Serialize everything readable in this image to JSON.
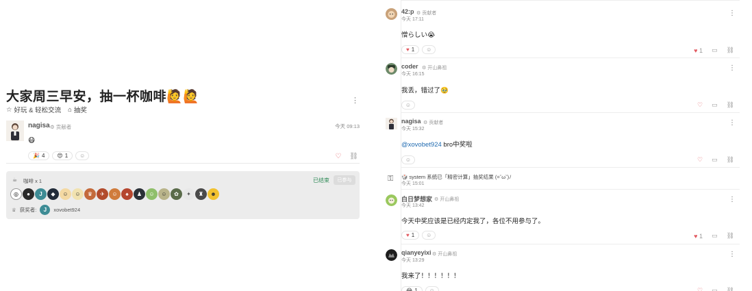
{
  "topic": {
    "title": "大家周三早安，抽一杯咖啡🙋🙋",
    "tags": [
      {
        "icon": "star-outline-icon",
        "label": "好玩 & 轻松交流"
      },
      {
        "icon": "tag-icon",
        "label": "抽奖"
      }
    ],
    "menu": "⋮"
  },
  "op": {
    "author": "nagisa",
    "role": "⚙ 贡献者",
    "time": "今天 09:13",
    "body": "😷",
    "reactions": [
      {
        "emoji": "🎉",
        "count": "4"
      },
      {
        "emoji": "😍",
        "count": "1"
      }
    ],
    "add_reaction": "☺"
  },
  "giveaway": {
    "icon": "☕",
    "prize": "咖啡  x 1",
    "status": "已结束",
    "button": "已参与",
    "participants": [
      {
        "bg": "#ffffff",
        "fg": "#000",
        "glyph": "◎"
      },
      {
        "bg": "#2a2a2a",
        "fg": "#fff",
        "glyph": "●"
      },
      {
        "bg": "#3e8c95",
        "fg": "#fff",
        "glyph": "J"
      },
      {
        "bg": "#222c3a",
        "fg": "#fff",
        "glyph": "◆"
      },
      {
        "bg": "#f4d9a3",
        "fg": "#333",
        "glyph": "☺"
      },
      {
        "bg": "#f1e2b0",
        "fg": "#333",
        "glyph": "☺"
      },
      {
        "bg": "#c46a3b",
        "fg": "#fff",
        "glyph": "♛"
      },
      {
        "bg": "#b24b2c",
        "fg": "#fff",
        "glyph": "✈"
      },
      {
        "bg": "#d07c3c",
        "fg": "#fff",
        "glyph": "☺"
      },
      {
        "bg": "#b5462f",
        "fg": "#fff",
        "glyph": "♠"
      },
      {
        "bg": "#2b3138",
        "fg": "#fff",
        "glyph": "♟"
      },
      {
        "bg": "#8fbf6a",
        "fg": "#fff",
        "glyph": "☺"
      },
      {
        "bg": "#b9b48a",
        "fg": "#333",
        "glyph": "☺"
      },
      {
        "bg": "#5a6b4a",
        "fg": "#fff",
        "glyph": "✿"
      },
      {
        "bg": "#e8e8e8",
        "fg": "#555",
        "glyph": "✦"
      },
      {
        "bg": "#4a4a4a",
        "fg": "#fff",
        "glyph": "♜"
      },
      {
        "bg": "#f2c230",
        "fg": "#333",
        "glyph": "☻"
      }
    ],
    "winner_label": "获奖者:",
    "winner_initial": "J",
    "winner_name": "xovobet924"
  },
  "replies": [
    {
      "author": "42:p",
      "role": "⚙ 贡献者",
      "time": "今天 17:11",
      "avatar_bg": "#c9a27a",
      "avatar_glyph": "☺",
      "body": "憎らしい😭",
      "reactions": [
        {
          "emoji": "❤️",
          "count": "1"
        }
      ],
      "like_count": "1",
      "liked": true
    },
    {
      "author": "coder",
      "role": "⚙ 开山鼻祖",
      "time": "今天 16:15",
      "avatar_bg": "#4a6a4a",
      "avatar_glyph": "◕",
      "body": "我丢，错过了🥹",
      "reactions": [],
      "like_count": "",
      "liked": false
    },
    {
      "author": "nagisa",
      "role": "⚙ 贡献者",
      "time": "今天 15:32",
      "avatar_bg": "#f2ede8",
      "avatar_glyph": "♞",
      "mention": "@xovobet924",
      "body": " bro中奖啦",
      "reactions": [],
      "like_count": "",
      "liked": false
    },
    {
      "author": "白日梦想家",
      "role": "⚙ 开山鼻祖",
      "time": "今天 13:42",
      "avatar_bg": "#9ac85e",
      "avatar_glyph": "☺",
      "body": "今天中奖应该是已经内定我了，各位不用参与了。",
      "reactions": [
        {
          "emoji": "❤️",
          "count": "1"
        }
      ],
      "like_count": "1",
      "liked": true
    },
    {
      "author": "qianyeyixi",
      "role": "⚙ 开山鼻祖",
      "time": "今天 13:29",
      "avatar_bg": "#1e1e1e",
      "avatar_glyph": "♚",
      "body": "我来了！！！！！！",
      "reactions": [
        {
          "emoji": "😂",
          "count": "1"
        }
      ],
      "like_count": "",
      "liked": false
    }
  ],
  "system": {
    "icon": "🎁",
    "text": "🎲 system 系统已「精密计算」抽奖结果 (=ˇωˇ)ﾉ",
    "time": "今天 15:01"
  },
  "icons": {
    "heart": "♡",
    "heart_filled": "♥",
    "reply": "▭",
    "link": "⛓",
    "add_reaction": "☺",
    "menu": "⋮"
  }
}
